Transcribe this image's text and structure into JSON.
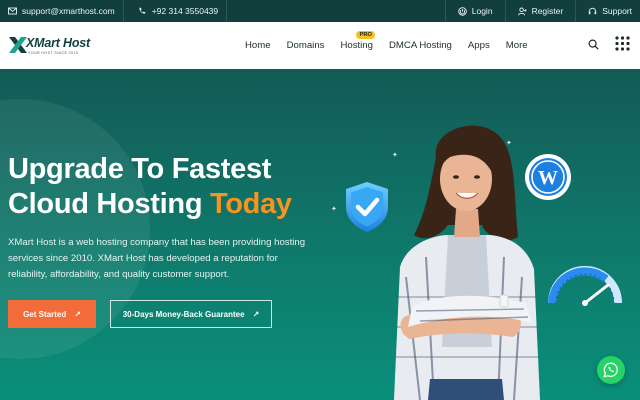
{
  "topbar": {
    "email": "support@xmarthost.com",
    "phone": "+92 314 3550439",
    "login": "Login",
    "register": "Register",
    "support": "Support",
    "icons": [
      "mail-icon",
      "phone-icon",
      "login-icon",
      "register-icon",
      "support-icon"
    ]
  },
  "nav": {
    "logo_text": "XMart Host",
    "logo_tagline": "YOUR HOST SINCE 2010",
    "menu": [
      "Home",
      "Domains",
      "Hosting",
      "DMCA Hosting",
      "Apps",
      "More"
    ],
    "pro_badge": "PRO",
    "icons": [
      "search-icon",
      "grid-menu-icon"
    ]
  },
  "hero": {
    "title_line1": "Upgrade To Fastest",
    "title_line2": "Cloud Hosting ",
    "title_accent": "Today",
    "description": "XMart Host is a web hosting company that has been providing hosting services since 2010. XMart Host has developed a reputation for reliability, affordability, and quality customer support.",
    "primary_button": "Get Started",
    "secondary_button": "30-Days Money-Back Guarantee",
    "arrow": "↗"
  },
  "colors": {
    "topbar": "#123f3d",
    "hero_top": "#135a55",
    "hero_bottom": "#0a8f7a",
    "accent": "#f7931e",
    "primary_button": "#f26b3a",
    "pro_badge": "#f7c21a",
    "whatsapp": "#25d366"
  }
}
